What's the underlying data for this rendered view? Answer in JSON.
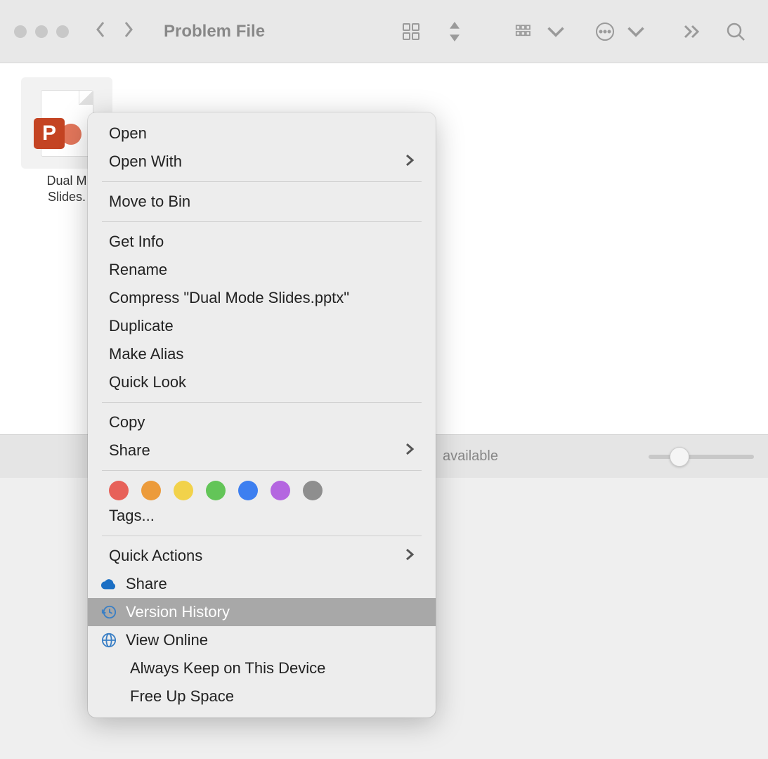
{
  "window": {
    "title": "Problem File"
  },
  "file": {
    "name_line1": "Dual M",
    "name_line2": "Slides.",
    "letter": "P"
  },
  "status": {
    "text": "available"
  },
  "menu": {
    "open": "Open",
    "open_with": "Open With",
    "move_to_bin": "Move to Bin",
    "get_info": "Get Info",
    "rename": "Rename",
    "compress": "Compress \"Dual Mode Slides.pptx\"",
    "duplicate": "Duplicate",
    "make_alias": "Make Alias",
    "quick_look": "Quick Look",
    "copy": "Copy",
    "share": "Share",
    "tags": "Tags...",
    "quick_actions": "Quick Actions",
    "onedrive_share": "Share",
    "version_history": "Version History",
    "view_online": "View Online",
    "always_keep": "Always Keep on This Device",
    "free_up": "Free Up Space"
  },
  "tag_colors": [
    "#e76159",
    "#ec9b3b",
    "#f2d24a",
    "#63c558",
    "#3d7ff0",
    "#b466e0",
    "#8e8e8e"
  ]
}
